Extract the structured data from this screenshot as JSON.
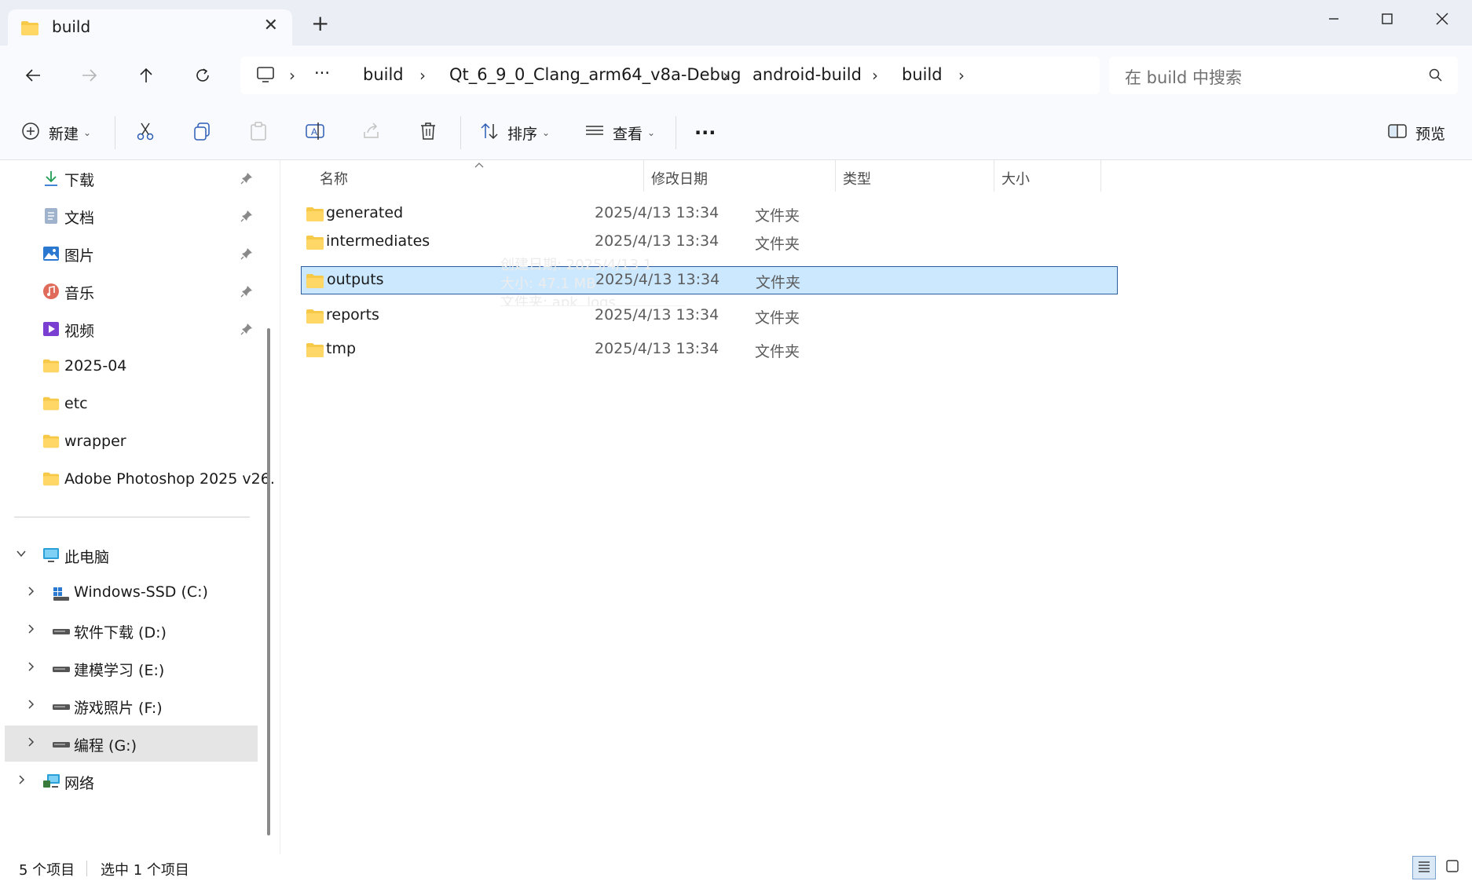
{
  "window": {
    "tab_title": "build",
    "tab_close": "✕",
    "new_tab": "+",
    "controls": [
      "minimize",
      "maximize",
      "close"
    ]
  },
  "nav": {
    "overflow": "···",
    "breadcrumbs": [
      "build",
      "Qt_6_9_0_Clang_arm64_v8a-Debug",
      "android-build",
      "build"
    ],
    "separator": "›",
    "search_placeholder": "在 build 中搜索"
  },
  "commands": {
    "new_label": "新建",
    "sort_label": "排序",
    "view_label": "查看",
    "more_label": "···",
    "preview_label": "预览"
  },
  "sidebar": {
    "quick_access": [
      {
        "label": "下载",
        "icon": "download-icon",
        "pinned": true
      },
      {
        "label": "文档",
        "icon": "documents-icon",
        "pinned": true
      },
      {
        "label": "图片",
        "icon": "pictures-icon",
        "pinned": true
      },
      {
        "label": "音乐",
        "icon": "music-icon",
        "pinned": true
      },
      {
        "label": "视频",
        "icon": "videos-icon",
        "pinned": true
      },
      {
        "label": "2025-04",
        "icon": "folder-icon",
        "pinned": false
      },
      {
        "label": "etc",
        "icon": "folder-icon",
        "pinned": false
      },
      {
        "label": "wrapper",
        "icon": "folder-icon",
        "pinned": false
      },
      {
        "label": "Adobe Photoshop 2025 v26.",
        "icon": "folder-icon",
        "pinned": false
      }
    ],
    "this_pc": "此电脑",
    "drives": [
      {
        "label": "Windows-SSD (C:)",
        "icon": "windows-drive-icon"
      },
      {
        "label": "软件下载 (D:)",
        "icon": "drive-icon"
      },
      {
        "label": "建模学习 (E:)",
        "icon": "drive-icon"
      },
      {
        "label": "游戏照片 (F:)",
        "icon": "drive-icon"
      },
      {
        "label": "编程 (G:)",
        "icon": "drive-icon",
        "selected": true
      }
    ],
    "network": "网络"
  },
  "columns": {
    "name": "名称",
    "date": "修改日期",
    "type": "类型",
    "size": "大小"
  },
  "files": [
    {
      "name": "generated",
      "date": "2025/4/13 13:34",
      "type": "文件夹"
    },
    {
      "name": "intermediates",
      "date": "2025/4/13 13:34",
      "type": "文件夹"
    },
    {
      "name": "outputs",
      "date": "2025/4/13 13:34",
      "type": "文件夹",
      "selected": true
    },
    {
      "name": "reports",
      "date": "2025/4/13 13:34",
      "type": "文件夹"
    },
    {
      "name": "tmp",
      "date": "2025/4/13 13:34",
      "type": "文件夹"
    }
  ],
  "tooltip": {
    "created": "创建日期: 2025/4/13 1",
    "size": "大小: 47.1 MB",
    "folders": "文件夹: apk, logs"
  },
  "status": {
    "item_count": "5 个项目",
    "selected_count": "选中 1 个项目"
  },
  "colors": {
    "selection_fill": "#cce8ff",
    "selection_border": "#2c5aa0",
    "folder": "#f7c948",
    "accent": "#0067c0"
  }
}
